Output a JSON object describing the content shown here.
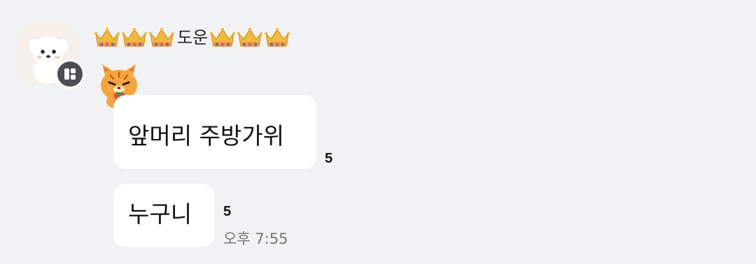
{
  "sender": {
    "name": "도운",
    "crowns_before": 3,
    "crowns_after": 3
  },
  "messages": [
    {
      "text": "앞머리 주방가위",
      "unread": "5"
    },
    {
      "text": "누구니",
      "unread": "5",
      "time": "오후 7:55"
    }
  ],
  "colors": {
    "background": "#f1f2f3",
    "bubble": "#ffffff",
    "timestamp": "#777777"
  }
}
